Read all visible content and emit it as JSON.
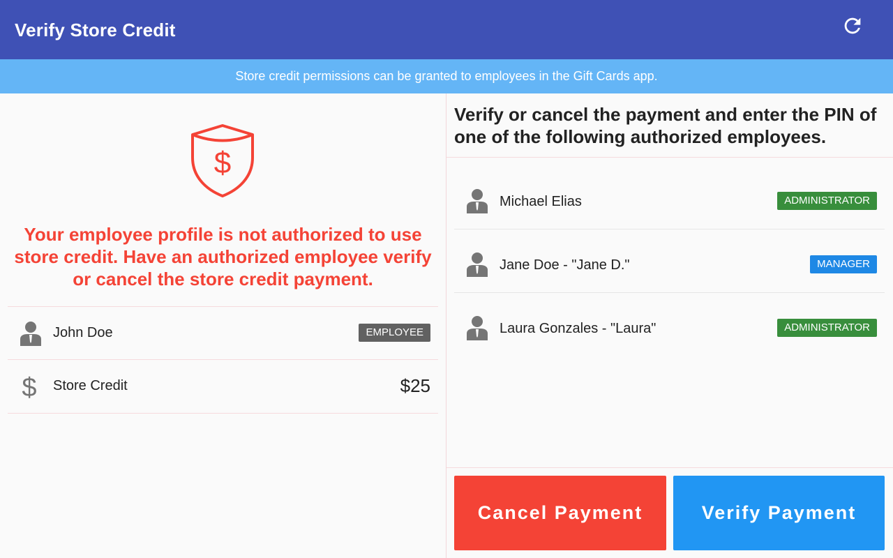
{
  "appbar": {
    "title": "Verify Store Credit",
    "refresh_icon": "refresh-icon"
  },
  "banner": {
    "text": "Store credit permissions can be granted to employees in the Gift Cards app."
  },
  "left": {
    "warning": "Your employee profile is not authorized to use store credit. Have an authorized employee verify or cancel the store credit payment.",
    "employee": {
      "name": "John Doe",
      "role": "EMPLOYEE"
    },
    "store_credit": {
      "label": "Store Credit",
      "amount": "$25"
    }
  },
  "right": {
    "instructions": "Verify or cancel the payment and enter the PIN of one of the following authorized employees.",
    "employees": [
      {
        "name": "Michael Elias",
        "role": "ADMINISTRATOR"
      },
      {
        "name": "Jane Doe - \"Jane D.\"",
        "role": "MANAGER"
      },
      {
        "name": "Laura Gonzales - \"Laura\"",
        "role": "ADMINISTRATOR"
      }
    ],
    "cancel_label": "Cancel Payment",
    "verify_label": "Verify Payment"
  },
  "colors": {
    "appbar": "#3f51b5",
    "banner": "#64b5f6",
    "warning": "#f44336",
    "admin_badge": "#388e3c",
    "manager_badge": "#1e88e5",
    "employee_badge": "#616161",
    "cancel": "#f44336",
    "verify": "#2196f3"
  }
}
